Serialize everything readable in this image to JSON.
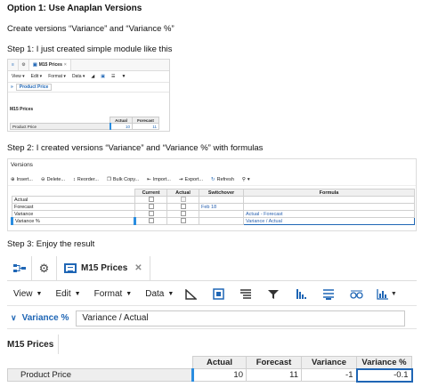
{
  "heading": "Option 1: Use Anaplan Versions",
  "intro": "Create versions “Variance” and “Variance %”",
  "step1": "Step 1: I just created simple module like this",
  "step2": "Step 2: I created versions “Variance” and “Variance %” with formulas",
  "step3": "Step 3: Enjoy the result",
  "small_module": {
    "tab_label": "M15 Prices",
    "toolbar": [
      "View",
      "Edit",
      "Format",
      "Data"
    ],
    "context_label": "Product Price",
    "module_title": "M15 Prices",
    "columns": [
      "Actual",
      "Forecast"
    ],
    "row_label": "Product Price",
    "values": [
      "10",
      "11"
    ]
  },
  "versions": {
    "title": "Versions",
    "toolbar": [
      "Insert...",
      "Delete...",
      "Reorder...",
      "Bulk Copy...",
      "Import...",
      "Export...",
      "Refresh"
    ],
    "columns": [
      "Current",
      "Actual",
      "Switchover",
      "Formula"
    ],
    "rows": [
      {
        "name": "Actual",
        "switchover": "",
        "formula": ""
      },
      {
        "name": "Forecast",
        "switchover": "Feb 18",
        "formula": ""
      },
      {
        "name": "Variance",
        "switchover": "",
        "formula": "Actual - Forecast"
      },
      {
        "name": "Variance %",
        "switchover": "",
        "formula": "Variance / Actual"
      }
    ]
  },
  "result_module": {
    "tab_label": "M15 Prices",
    "toolbar": [
      "View",
      "Edit",
      "Format",
      "Data"
    ],
    "context_label": "Variance %",
    "context_value": "Variance / Actual",
    "module_title": "M15 Prices",
    "columns": [
      "Actual",
      "Forecast",
      "Variance",
      "Variance %"
    ],
    "row_label": "Product Price",
    "values": [
      "10",
      "11",
      "-1",
      "-0.1"
    ]
  },
  "colors": {
    "accent_blue": "#1f66b5",
    "light_blue": "#2a8de0"
  }
}
